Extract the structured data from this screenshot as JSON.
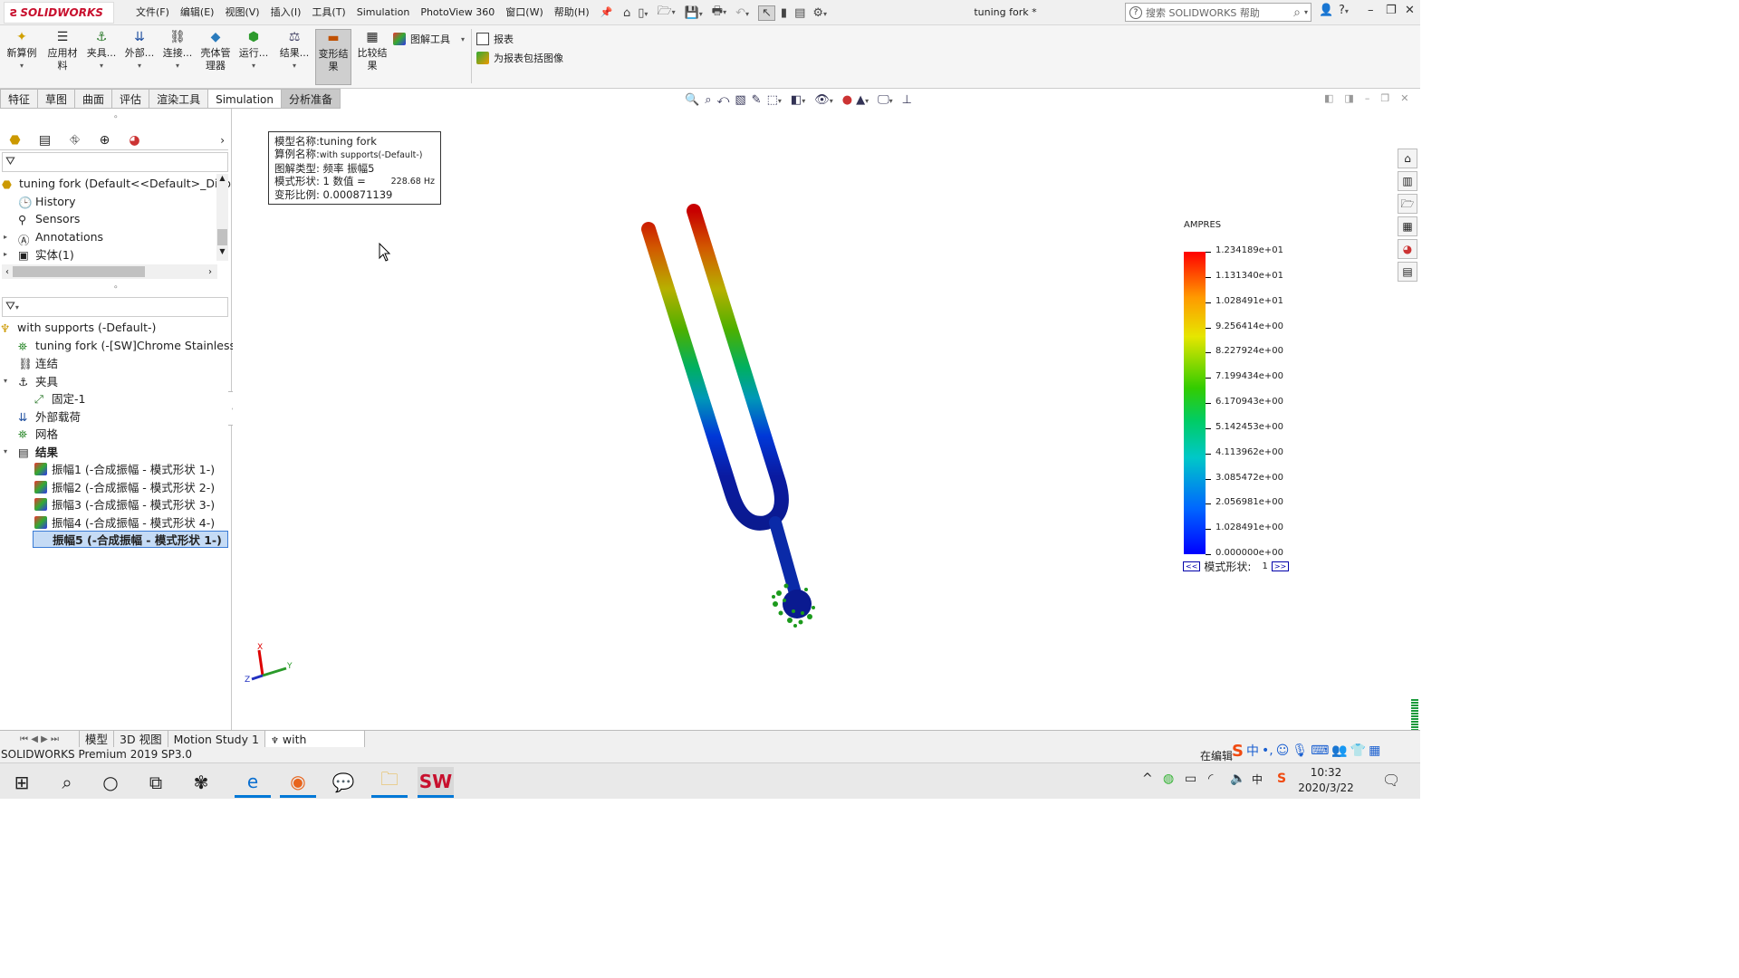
{
  "titlebar": {
    "logo": "SOLIDWORKS",
    "menus": [
      "文件(F)",
      "编辑(E)",
      "视图(V)",
      "插入(I)",
      "工具(T)",
      "Simulation",
      "PhotoView 360",
      "窗口(W)",
      "帮助(H)"
    ],
    "document_title": "tuning fork *",
    "search_placeholder": "搜索 SOLIDWORKS 帮助"
  },
  "ribbon": {
    "new_study": "新算例",
    "apply_material": "应用材料",
    "fixtures": "夹具...",
    "external_loads": "外部...",
    "connections": "连接...",
    "shell_manager": "壳体管理器",
    "run": "运行...",
    "results": "结果...",
    "deformed_result": "变形结果",
    "compare_results": "比较结果",
    "plot_tools": "图解工具",
    "report": "报表",
    "include_image": "为报表包括图像"
  },
  "command_tabs": [
    "特征",
    "草图",
    "曲面",
    "评估",
    "渲染工具",
    "Simulation",
    "分析准备"
  ],
  "feature_tree": {
    "root": "tuning fork  (Default<<Default>_Disp",
    "items": [
      "History",
      "Sensors",
      "Annotations",
      "实体(1)"
    ]
  },
  "study_tree": {
    "study": "with supports (-Default-)",
    "part": "tuning fork (-[SW]Chrome Stainless Stee",
    "connections": "连结",
    "fixtures": "夹具",
    "fixture_1": "固定-1",
    "external_loads": "外部载荷",
    "mesh": "网格",
    "results": "结果",
    "result_items": [
      "振幅1 (-合成振幅 - 模式形状 1-)",
      "振幅2 (-合成振幅 - 模式形状 2-)",
      "振幅3 (-合成振幅 - 模式形状 3-)",
      "振幅4 (-合成振幅 - 模式形状 4-)",
      "振幅5 (-合成振幅 - 模式形状 1-)"
    ],
    "selected_index": 4
  },
  "info_box": {
    "model_name": "模型名称:tuning fork",
    "study_name_label": "算例名称:",
    "study_name": "with supports(-Default-)",
    "plot_type": "图解类型: 频率 振幅5",
    "mode_shape": "模式形状: 1  数值 =",
    "frequency": "228.68 Hz",
    "deformation_scale": "变形比例: 0.000871139"
  },
  "legend": {
    "title": "AMPRES",
    "labels": [
      "1.234189e+01",
      "1.131340e+01",
      "1.028491e+01",
      "9.256414e+00",
      "8.227924e+00",
      "7.199434e+00",
      "6.170943e+00",
      "5.142453e+00",
      "4.113962e+00",
      "3.085472e+00",
      "2.056981e+00",
      "1.028491e+00",
      "0.000000e+00"
    ],
    "prev": "<<",
    "mode_label": "模式形状:",
    "mode_value": "1",
    "next": ">>"
  },
  "triad": {
    "x": "X",
    "y": "Y",
    "z": "Z"
  },
  "bottom_tabs": [
    "模型",
    "3D 视图",
    "Motion Study 1",
    "with supports"
  ],
  "status": {
    "product": "SOLIDWORKS Premium 2019 SP3.0",
    "editing": "在编辑"
  },
  "taskbar": {
    "time": "10:32",
    "date": "2020/3/22",
    "ime": "中"
  },
  "colors": {
    "accent": "#0078d7",
    "brand_red": "#c8102e",
    "selection": "#c5dbf5"
  }
}
